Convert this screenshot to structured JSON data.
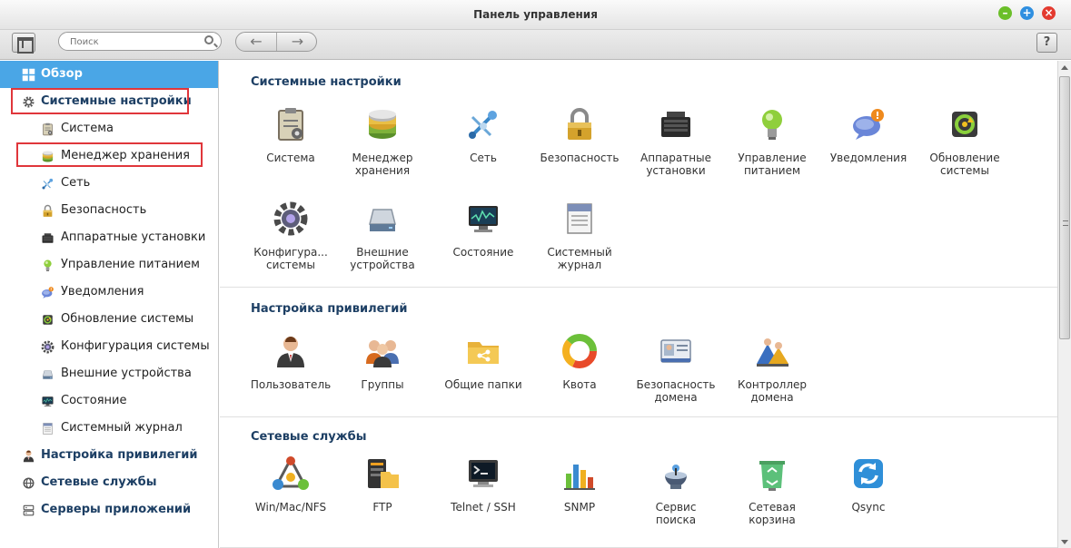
{
  "window": {
    "title": "Панель управления"
  },
  "toolbar": {
    "search_placeholder": "Поиск",
    "back_glyph": "←",
    "forward_glyph": "→",
    "help_label": "?"
  },
  "colors": {
    "accent": "#4aa6e6",
    "heading": "#1d3f64",
    "highlight_box": "#e0363b"
  },
  "sidebar": {
    "items": [
      {
        "label": "Обзор",
        "level": "top",
        "icon": "overview-icon",
        "active": true
      },
      {
        "label": "Системные настройки",
        "level": "top",
        "icon": "gear-icon",
        "highlighted": true
      },
      {
        "label": "Система",
        "level": "sub",
        "icon": "clipboard-icon"
      },
      {
        "label": "Менеджер хранения",
        "level": "sub",
        "icon": "storage-icon",
        "highlighted": true
      },
      {
        "label": "Сеть",
        "level": "sub",
        "icon": "network-icon"
      },
      {
        "label": "Безопасность",
        "level": "sub",
        "icon": "lock-icon"
      },
      {
        "label": "Аппаратные установки",
        "level": "sub",
        "icon": "hardware-icon"
      },
      {
        "label": "Управление питанием",
        "level": "sub",
        "icon": "bulb-icon"
      },
      {
        "label": "Уведомления",
        "level": "sub",
        "icon": "notification-icon"
      },
      {
        "label": "Обновление системы",
        "level": "sub",
        "icon": "update-icon"
      },
      {
        "label": "Конфигурация системы",
        "level": "sub",
        "icon": "config-icon"
      },
      {
        "label": "Внешние устройства",
        "level": "sub",
        "icon": "external-drive-icon"
      },
      {
        "label": "Состояние",
        "level": "sub",
        "icon": "monitor-icon"
      },
      {
        "label": "Системный журнал",
        "level": "sub",
        "icon": "log-icon"
      },
      {
        "label": "Настройка привилегий",
        "level": "top",
        "icon": "user-icon"
      },
      {
        "label": "Сетевые службы",
        "level": "top",
        "icon": "globe-icon"
      },
      {
        "label": "Серверы приложений",
        "level": "top",
        "icon": "server-icon"
      }
    ]
  },
  "main": {
    "sections": [
      {
        "title": "Системные настройки",
        "tiles": [
          {
            "label": "Система",
            "icon": "clipboard-icon"
          },
          {
            "label": "Менеджер\nхранения",
            "icon": "storage-icon"
          },
          {
            "label": "Сеть",
            "icon": "network-icon"
          },
          {
            "label": "Безопасность",
            "icon": "lock-icon"
          },
          {
            "label": "Аппаратные\nустановки",
            "icon": "hardware-icon"
          },
          {
            "label": "Управление\nпитанием",
            "icon": "bulb-icon"
          },
          {
            "label": "Уведомления",
            "icon": "notification-icon"
          },
          {
            "label": "Обновление\nсистемы",
            "icon": "update-icon"
          },
          {
            "label": "Конфигура...\nсистемы",
            "icon": "config-icon"
          },
          {
            "label": "Внешние\nустройства",
            "icon": "external-drive-icon"
          },
          {
            "label": "Состояние",
            "icon": "monitor-icon"
          },
          {
            "label": "Системный\nжурнал",
            "icon": "log-icon"
          }
        ]
      },
      {
        "title": "Настройка привилегий",
        "tiles": [
          {
            "label": "Пользователь",
            "icon": "user-icon"
          },
          {
            "label": "Группы",
            "icon": "group-icon"
          },
          {
            "label": "Общие папки",
            "icon": "shared-folder-icon"
          },
          {
            "label": "Квота",
            "icon": "quota-icon"
          },
          {
            "label": "Безопасность\nдомена",
            "icon": "domain-security-icon"
          },
          {
            "label": "Контроллер\nдомена",
            "icon": "domain-controller-icon"
          }
        ]
      },
      {
        "title": "Сетевые службы",
        "tiles": [
          {
            "label": "Win/Mac/NFS",
            "icon": "win-mac-nfs-icon"
          },
          {
            "label": "FTP",
            "icon": "ftp-icon"
          },
          {
            "label": "Telnet / SSH",
            "icon": "terminal-icon"
          },
          {
            "label": "SNMP",
            "icon": "snmp-icon"
          },
          {
            "label": "Сервис\nпоиска",
            "icon": "discovery-icon"
          },
          {
            "label": "Сетевая\nкорзина",
            "icon": "recycle-bin-icon"
          },
          {
            "label": "Qsync",
            "icon": "qsync-icon"
          }
        ]
      }
    ]
  }
}
